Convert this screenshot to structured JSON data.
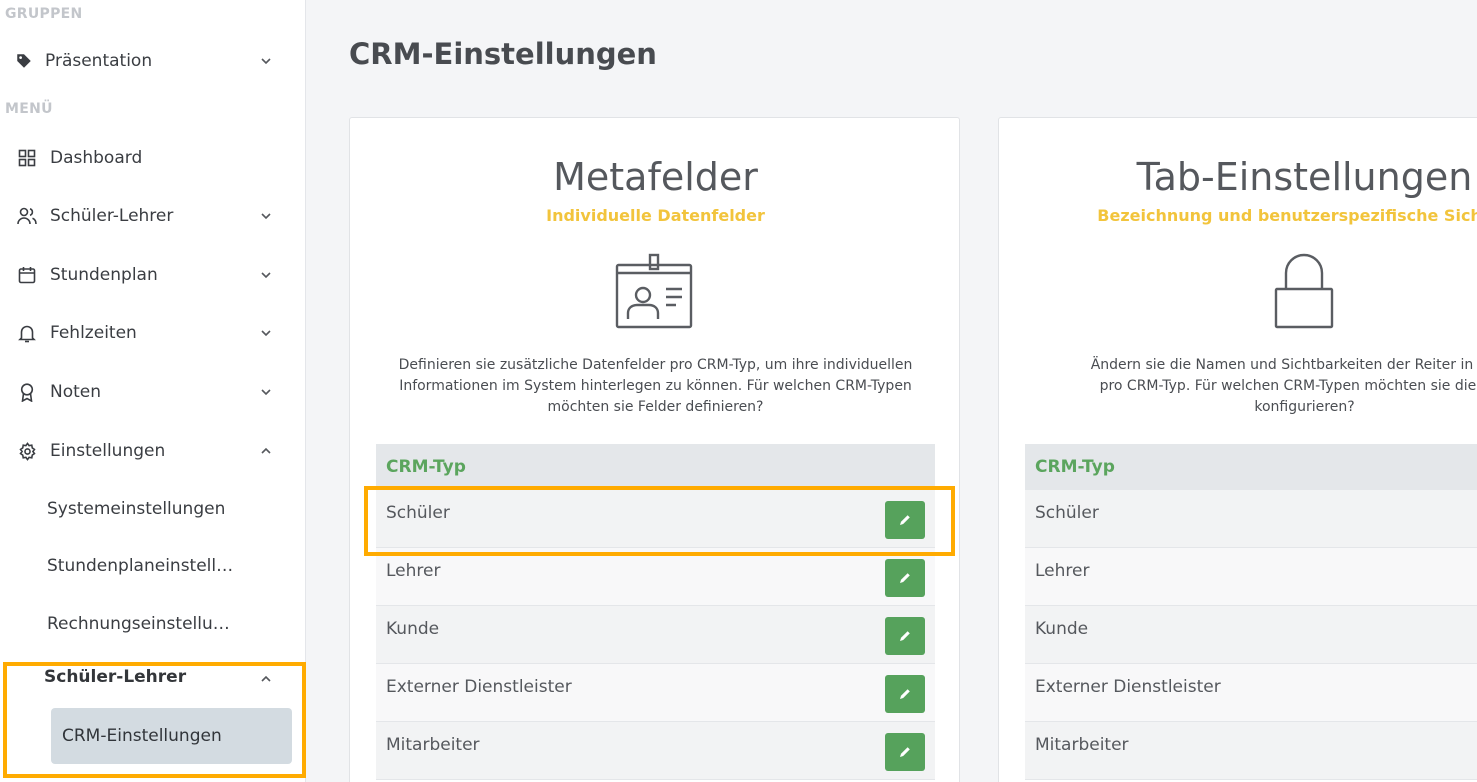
{
  "sidebar": {
    "groups_label": "GRUPPEN",
    "group_item": {
      "label": "Präsentation",
      "icon": "tag-icon"
    },
    "menu_label": "MENÜ",
    "items": [
      {
        "label": "Dashboard",
        "icon": "dashboard-grid-icon",
        "chevron": "none"
      },
      {
        "label": "Schüler-Lehrer",
        "icon": "users-icon",
        "chevron": "down"
      },
      {
        "label": "Stundenplan",
        "icon": "calendar-icon",
        "chevron": "down"
      },
      {
        "label": "Fehlzeiten",
        "icon": "bell-icon",
        "chevron": "down"
      },
      {
        "label": "Noten",
        "icon": "award-icon",
        "chevron": "down"
      },
      {
        "label": "Einstellungen",
        "icon": "gear-icon",
        "chevron": "up"
      }
    ],
    "sub_items": [
      {
        "label": "Systemeinstellungen"
      },
      {
        "label": "Stundenplaneinstell…"
      },
      {
        "label": "Rechnungseinstellu…"
      }
    ],
    "sub_group": {
      "label": "Schüler-Lehrer",
      "chevron": "up"
    },
    "active_item": {
      "label": "CRM-Einstellungen"
    }
  },
  "main": {
    "title": "CRM-Einstellungen",
    "cards": [
      {
        "title": "Metafelder",
        "subtitle": "Individuelle Datenfelder",
        "icon": "id-badge-icon",
        "description_lines": [
          "Definieren sie zusätzliche Datenfelder pro CRM-Typ, um ihre individuellen",
          "Informationen im System hinterlegen zu können. Für welchen CRM-Typen",
          "möchten sie Felder definieren?"
        ],
        "table_header": "CRM-Typ",
        "rows": [
          "Schüler",
          "Lehrer",
          "Kunde",
          "Externer Dienstleister",
          "Mitarbeiter"
        ]
      },
      {
        "title": "Tab-Einstellungen",
        "subtitle": "Bezeichnung und benutzerspezifische Sichtba",
        "icon": "lock-icon",
        "description_lines": [
          "Ändern sie die Namen und Sichtbarkeiten der Reiter in den C",
          "pro CRM-Typ. Für welchen CRM-Typen möchten sie die Tab-",
          "konfigurieren?"
        ],
        "table_header": "CRM-Typ",
        "rows": [
          "Schüler",
          "Lehrer",
          "Kunde",
          "Externer Dienstleister",
          "Mitarbeiter"
        ]
      }
    ]
  },
  "colors": {
    "accent_green": "#56a25c",
    "header_green": "#5ba55e",
    "subtitle_yellow": "#f2c43c",
    "highlight_orange": "#ffab00",
    "active_bg": "#d3dbe1"
  }
}
